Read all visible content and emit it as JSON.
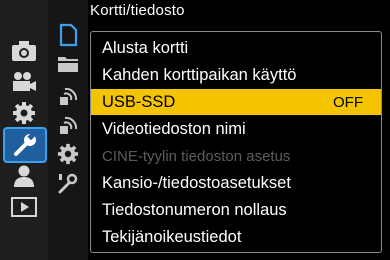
{
  "header": {
    "title": "Kortti/tiedosto"
  },
  "outer_tabs": [
    {
      "icon": "camera-icon",
      "active": false
    },
    {
      "icon": "video-camera-icon",
      "active": false
    },
    {
      "icon": "gear-icon",
      "active": false
    },
    {
      "icon": "wrench-icon",
      "active": true
    },
    {
      "icon": "person-icon",
      "active": false
    },
    {
      "icon": "playback-icon",
      "active": false
    }
  ],
  "inner_tabs": [
    {
      "icon": "memory-card-icon",
      "active": true
    },
    {
      "icon": "folder-icon",
      "active": false
    },
    {
      "icon": "wireless-1-icon",
      "active": false
    },
    {
      "icon": "wireless-2-icon",
      "active": false
    },
    {
      "icon": "gear-icon",
      "active": false
    },
    {
      "icon": "tool-icon",
      "active": false
    }
  ],
  "menu": {
    "items": [
      {
        "label": "Alusta kortti",
        "value": "",
        "state": "normal"
      },
      {
        "label": "Kahden korttipaikan käyttö",
        "value": "",
        "state": "normal"
      },
      {
        "label": "USB-SSD",
        "value": "OFF",
        "state": "selected"
      },
      {
        "label": "Videotiedoston nimi",
        "value": "",
        "state": "normal"
      },
      {
        "label": "CINE-tyylin tiedoston asetus",
        "value": "",
        "state": "disabled"
      },
      {
        "label": "Kansio-/tiedostoasetukset",
        "value": "",
        "state": "normal"
      },
      {
        "label": "Tiedostonumeron nollaus",
        "value": "",
        "state": "normal"
      },
      {
        "label": "Tekijänoikeustiedot",
        "value": "",
        "state": "normal"
      }
    ]
  },
  "colors": {
    "accent_yellow": "#f5c400",
    "active_tab_blue": "#1f5f9e",
    "disabled_text": "#5c5c5c"
  }
}
